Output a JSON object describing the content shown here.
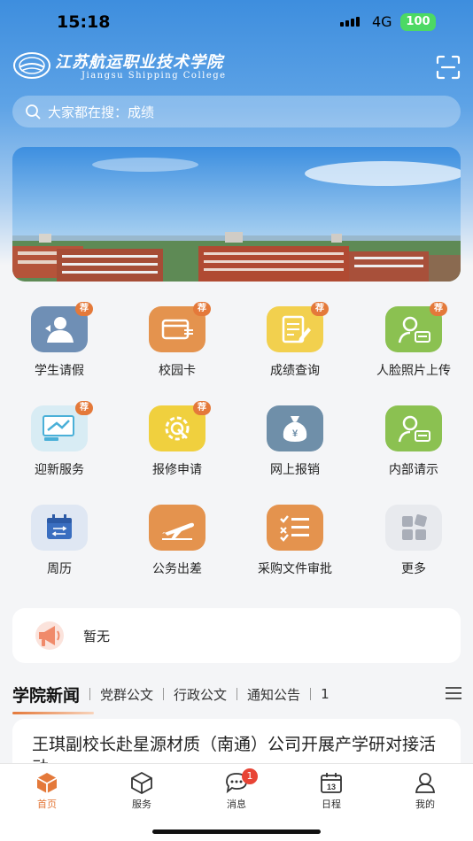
{
  "status_bar": {
    "time": "15:18",
    "network": "4G",
    "battery": "100"
  },
  "header": {
    "logo_cn": "江苏航运职业技术学院",
    "logo_en": "Jiangsu Shipping College"
  },
  "search": {
    "placeholder": "大家都在搜：成绩"
  },
  "apps": {
    "items": [
      {
        "label": "学生请假",
        "tag": "荐"
      },
      {
        "label": "校园卡",
        "tag": "荐"
      },
      {
        "label": "成绩查询",
        "tag": "荐"
      },
      {
        "label": "人脸照片上传",
        "tag": "荐"
      },
      {
        "label": "迎新服务",
        "tag": "荐"
      },
      {
        "label": "报修申请",
        "tag": "荐"
      },
      {
        "label": "网上报销"
      },
      {
        "label": "内部请示"
      },
      {
        "label": "周历"
      },
      {
        "label": "公务出差"
      },
      {
        "label": "采购文件审批"
      },
      {
        "label": "更多"
      }
    ]
  },
  "notice": {
    "text": "暂无"
  },
  "news_tabs": {
    "tabs": [
      "学院新闻",
      "党群公文",
      "行政公文",
      "通知公告",
      "1"
    ]
  },
  "news": {
    "items": [
      {
        "title": "王琪副校长赴星源材质（南通）公司开展产学研对接活动"
      }
    ]
  },
  "bottom_nav": {
    "items": [
      {
        "label": "首页"
      },
      {
        "label": "服务"
      },
      {
        "label": "消息",
        "badge": "1"
      },
      {
        "label": "日程"
      },
      {
        "label": "我的"
      }
    ]
  },
  "colors": {
    "accent": "#e4793a",
    "header_blue": "#3e8ede",
    "badge_red": "#e84435"
  }
}
